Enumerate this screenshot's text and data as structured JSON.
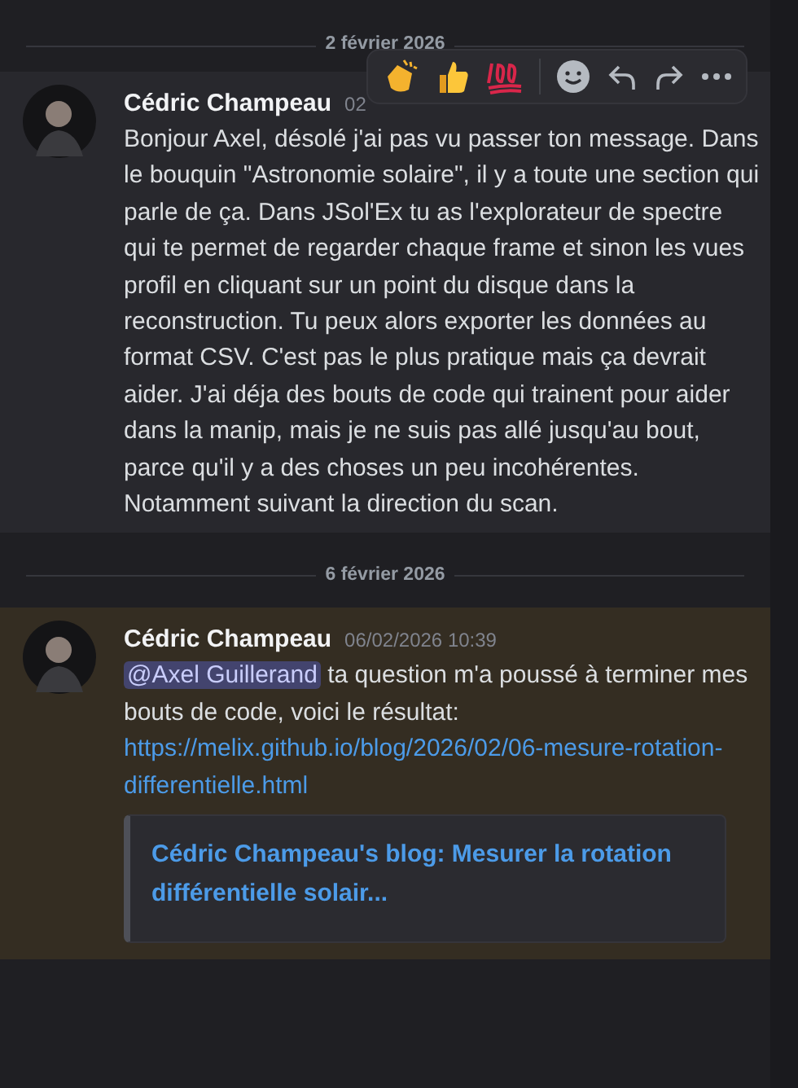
{
  "feed": [
    {
      "kind": "divider",
      "label": "2 février 2026"
    },
    {
      "kind": "message",
      "author": "Cédric Champeau",
      "timestamp": "02",
      "hovered": true,
      "mentioned": false,
      "segments": [
        {
          "kind": "text",
          "text": "Bonjour Axel, désolé j'ai pas vu passer ton message. Dans le bouquin \"Astronomie solaire\", il y a toute une section qui parle de ça. Dans JSol'Ex tu as l'explorateur de spectre qui te permet de regarder chaque frame et sinon les vues profil en cliquant sur un point du disque dans la reconstruction. Tu peux alors exporter les données au format CSV. C'est pas le plus pratique mais ça devrait aider. J'ai déja des bouts de code qui trainent pour aider dans la manip, mais je ne suis pas allé jusqu'au bout, parce qu'il y a des choses un peu incohérentes. Notamment suivant la direction du scan."
        }
      ]
    },
    {
      "kind": "divider",
      "label": "6 février 2026"
    },
    {
      "kind": "message",
      "author": "Cédric Champeau",
      "timestamp": "06/02/2026 10:39",
      "hovered": false,
      "mentioned": true,
      "segments": [
        {
          "kind": "mention",
          "text": "@Axel Guillerand"
        },
        {
          "kind": "text",
          "text": " ta question m'a poussé à terminer mes bouts de code, voici le résultat:"
        }
      ],
      "link": "https://melix.github.io/blog/2026/02/06-mesure-rotation-differentielle.html",
      "embed": {
        "title": "Cédric Champeau's blog: Mesurer la rotation différentielle solair..."
      }
    }
  ]
}
